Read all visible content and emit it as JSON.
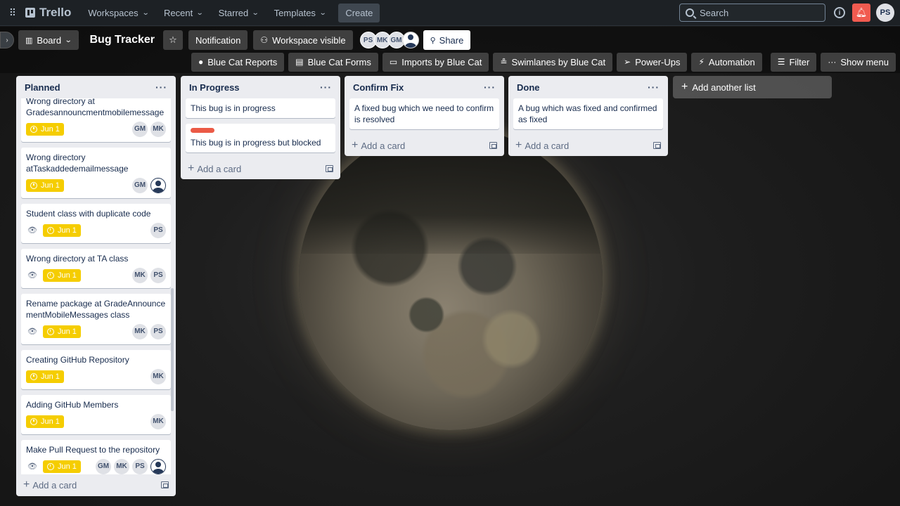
{
  "nav": {
    "logo": "Trello",
    "menus": [
      "Workspaces",
      "Recent",
      "Starred",
      "Templates"
    ],
    "create": "Create",
    "search_placeholder": "Search",
    "user_initials": "PS"
  },
  "board": {
    "view": "Board",
    "title": "Bug Tracker",
    "notification": "Notification",
    "visibility": "Workspace visible",
    "members": [
      "PS",
      "MK",
      "GM"
    ],
    "share": "Share",
    "powerups": [
      "Blue Cat Reports",
      "Blue Cat Forms",
      "Imports by Blue Cat",
      "Swimlanes by Blue Cat",
      "Power-Ups",
      "Automation"
    ],
    "filter": "Filter",
    "show_menu": "Show menu",
    "add_list": "Add another list",
    "add_card": "Add a card"
  },
  "lists": [
    {
      "title": "Planned",
      "cards": [
        {
          "title": "Wrong directory at Gradesannouncmentmobilemessage",
          "due": "Jun 1",
          "watch": false,
          "members": [
            "GM",
            "MK"
          ]
        },
        {
          "title": "Wrong directory atTaskaddedemailmessage",
          "due": "Jun 1",
          "watch": false,
          "members": [
            "GM",
            "user"
          ]
        },
        {
          "title": "Student class with duplicate code",
          "due": "Jun 1",
          "watch": true,
          "members": [
            "PS"
          ]
        },
        {
          "title": "Wrong directory at TA class",
          "due": "Jun 1",
          "watch": true,
          "members": [
            "MK",
            "PS"
          ]
        },
        {
          "title": "Rename package at GradeAnnouncementMobileMessages class",
          "due": "Jun 1",
          "watch": true,
          "members": [
            "MK",
            "PS"
          ]
        },
        {
          "title": "Creating GitHub Repository",
          "due": "Jun 1",
          "watch": false,
          "members": [
            "MK"
          ]
        },
        {
          "title": "Adding GitHub Members",
          "due": "Jun 1",
          "watch": false,
          "members": [
            "MK"
          ]
        },
        {
          "title": "Make Pull Request to the repository",
          "due": "Jun 1",
          "watch": true,
          "members": [
            "GM",
            "MK",
            "PS",
            "user"
          ]
        }
      ]
    },
    {
      "title": "In Progress",
      "cards": [
        {
          "title": "This bug is in progress"
        },
        {
          "title": "This bug is in progress but blocked",
          "label": "#eb5a46"
        }
      ]
    },
    {
      "title": "Confirm Fix",
      "cards": [
        {
          "title": "A fixed bug which we need to confirm is resolved"
        }
      ]
    },
    {
      "title": "Done",
      "cards": [
        {
          "title": "A bug which was fixed and confirmed as fixed"
        }
      ]
    }
  ]
}
